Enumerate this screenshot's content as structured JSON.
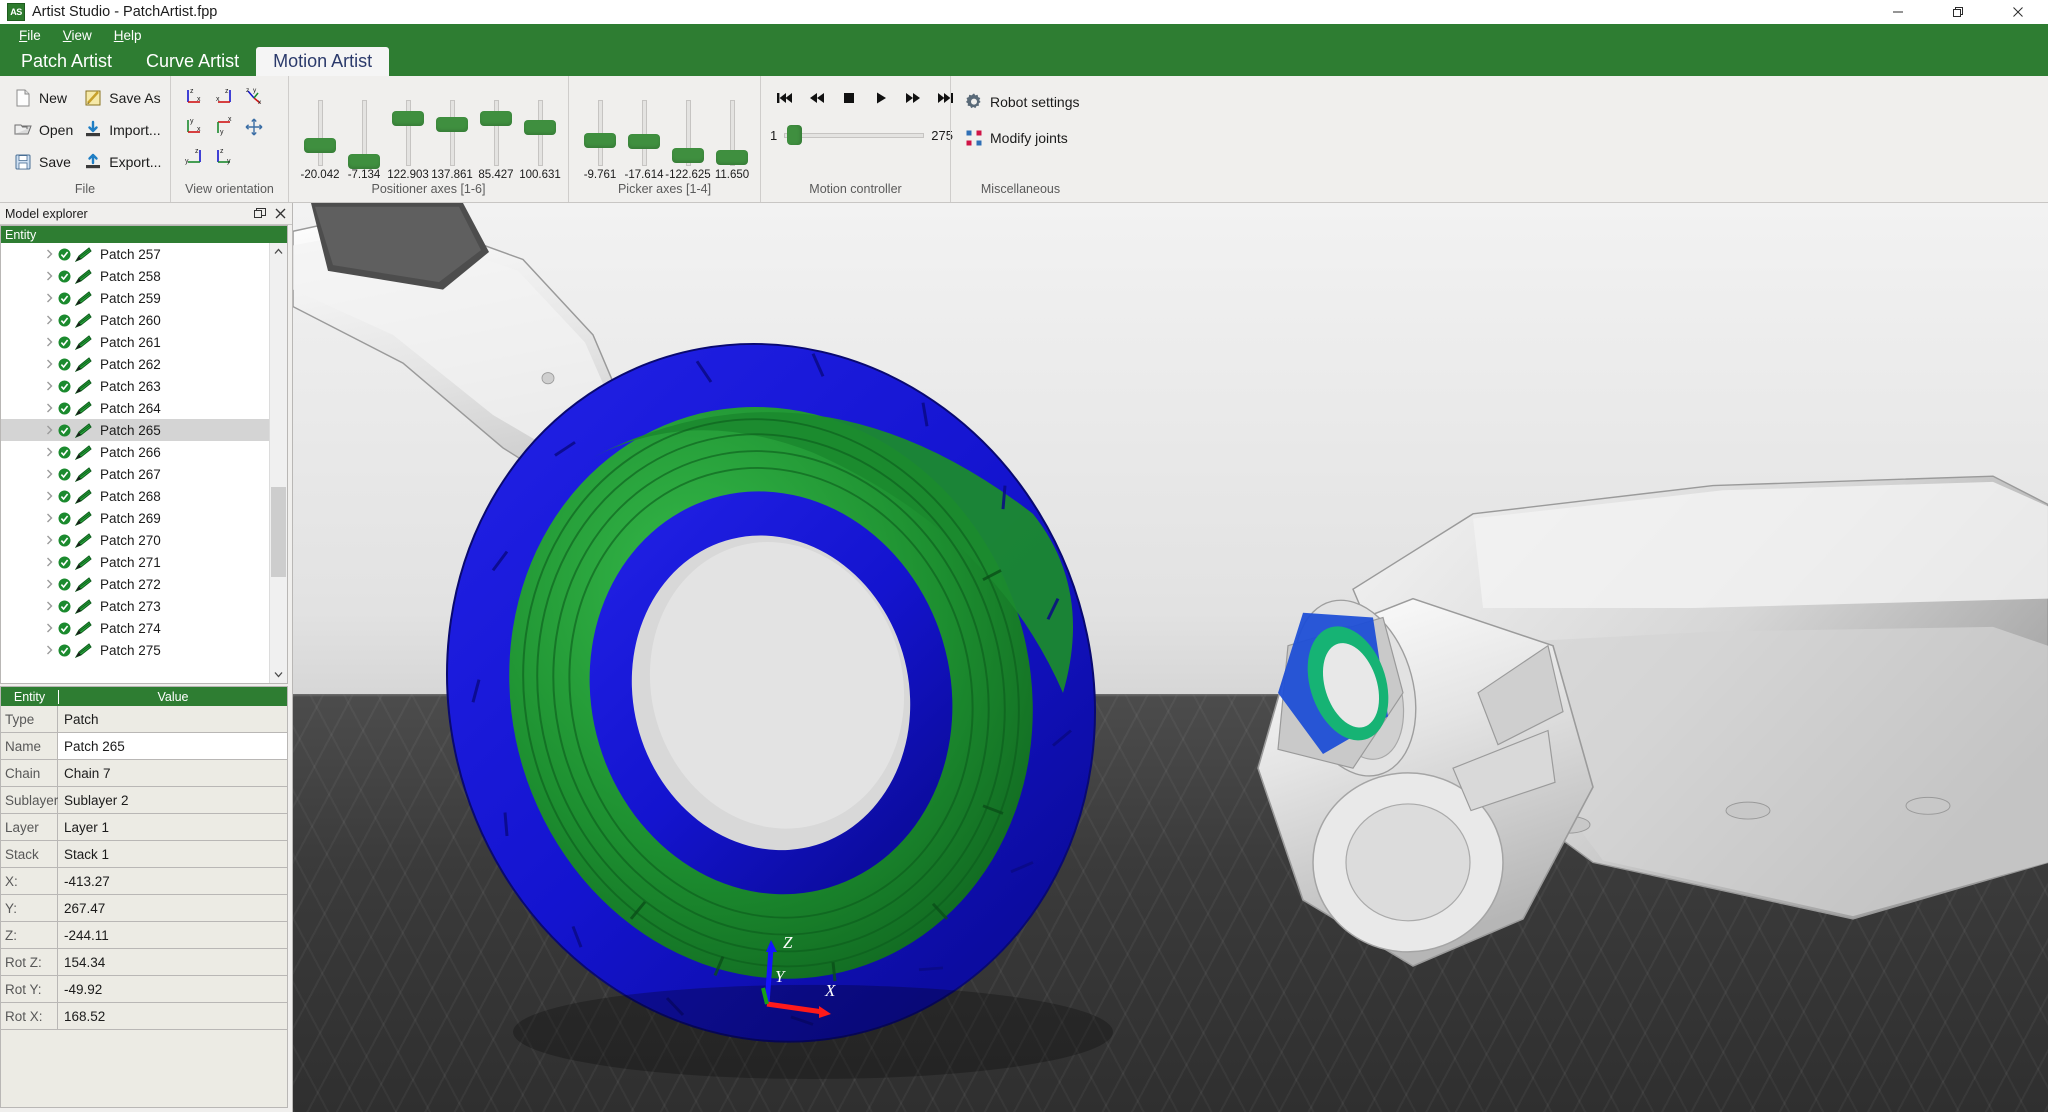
{
  "window": {
    "title": "Artist Studio - PatchArtist.fpp",
    "app_icon": "AS",
    "controls": [
      {
        "name": "minimize",
        "glyph": "minimize-icon"
      },
      {
        "name": "restore",
        "glyph": "restore-icon"
      },
      {
        "name": "close",
        "glyph": "close-icon"
      }
    ]
  },
  "menubar": {
    "items": [
      {
        "label": "File",
        "accel": "F"
      },
      {
        "label": "View",
        "accel": "V"
      },
      {
        "label": "Help",
        "accel": "H"
      }
    ]
  },
  "ribbon_tabs": [
    {
      "label": "Patch Artist",
      "active": false
    },
    {
      "label": "Curve Artist",
      "active": false
    },
    {
      "label": "Motion Artist",
      "active": true
    }
  ],
  "ribbon": {
    "file_group": {
      "label": "File",
      "items": [
        {
          "label": "New",
          "icon": "new-document-icon"
        },
        {
          "label": "Save As",
          "icon": "save-as-icon"
        },
        {
          "label": "Open",
          "icon": "open-folder-icon"
        },
        {
          "label": "Import...",
          "icon": "import-icon"
        },
        {
          "label": "Save",
          "icon": "save-icon"
        },
        {
          "label": "Export...",
          "icon": "export-icon"
        }
      ]
    },
    "view_orientation": {
      "label": "View orientation",
      "buttons": [
        {
          "name": "view-zx-icon"
        },
        {
          "name": "view-xz-icon"
        },
        {
          "name": "view-zyx-isometric-icon"
        },
        {
          "name": "view-yx-icon"
        },
        {
          "name": "view-xy-icon"
        },
        {
          "name": "view-fit-move-icon"
        },
        {
          "name": "view-yz-icon"
        },
        {
          "name": "view-zy-icon"
        }
      ]
    },
    "positioner_axes": {
      "label": "Positioner axes [1-6]",
      "axes": [
        {
          "value": "-20.042",
          "pct": 58
        },
        {
          "value": "-7.134",
          "pct": 82
        },
        {
          "value": "122.903",
          "pct": 16
        },
        {
          "value": "137.861",
          "pct": 26
        },
        {
          "value": "85.427",
          "pct": 17
        },
        {
          "value": "100.631",
          "pct": 31
        }
      ]
    },
    "picker_axes": {
      "label": "Picker axes [1-4]",
      "axes": [
        {
          "value": "-9.761",
          "pct": 50
        },
        {
          "value": "-17.614",
          "pct": 52
        },
        {
          "value": "-122.625",
          "pct": 72
        },
        {
          "value": "11.650",
          "pct": 75
        }
      ]
    },
    "motion_controller": {
      "label": "Motion controller",
      "buttons": [
        {
          "name": "skip-to-start-button",
          "glyph": "skip-back-icon"
        },
        {
          "name": "rewind-button",
          "glyph": "rewind-icon"
        },
        {
          "name": "stop-button",
          "glyph": "stop-icon"
        },
        {
          "name": "play-button",
          "glyph": "play-icon"
        },
        {
          "name": "fast-forward-button",
          "glyph": "fast-forward-icon"
        },
        {
          "name": "skip-to-end-button",
          "glyph": "skip-forward-icon"
        }
      ],
      "frame_min": "1",
      "frame_max": "275",
      "frame_pct": 2
    },
    "miscellaneous": {
      "label": "Miscellaneous",
      "items": [
        {
          "label": "Robot settings",
          "icon": "gear-icon"
        },
        {
          "label": "Modify joints",
          "icon": "joints-icon"
        }
      ]
    }
  },
  "model_explorer": {
    "title": "Model explorer",
    "column_header": "Entity",
    "items": [
      {
        "label": "Patch 257",
        "selected": false
      },
      {
        "label": "Patch 258",
        "selected": false
      },
      {
        "label": "Patch 259",
        "selected": false
      },
      {
        "label": "Patch 260",
        "selected": false
      },
      {
        "label": "Patch 261",
        "selected": false
      },
      {
        "label": "Patch 262",
        "selected": false
      },
      {
        "label": "Patch 263",
        "selected": false
      },
      {
        "label": "Patch 264",
        "selected": false
      },
      {
        "label": "Patch 265",
        "selected": true
      },
      {
        "label": "Patch 266",
        "selected": false
      },
      {
        "label": "Patch 267",
        "selected": false
      },
      {
        "label": "Patch 268",
        "selected": false
      },
      {
        "label": "Patch 269",
        "selected": false
      },
      {
        "label": "Patch 270",
        "selected": false
      },
      {
        "label": "Patch 271",
        "selected": false
      },
      {
        "label": "Patch 272",
        "selected": false
      },
      {
        "label": "Patch 273",
        "selected": false
      },
      {
        "label": "Patch 274",
        "selected": false
      },
      {
        "label": "Patch 275",
        "selected": false
      }
    ]
  },
  "properties": {
    "headers": {
      "key": "Entity",
      "value": "Value"
    },
    "rows": [
      {
        "key": "Type",
        "value": "Patch",
        "editing": false
      },
      {
        "key": "Name",
        "value": "Patch 265",
        "editing": true
      },
      {
        "key": "Chain",
        "value": "Chain 7",
        "editing": false
      },
      {
        "key": "Sublayer",
        "value": "Sublayer 2",
        "editing": false
      },
      {
        "key": "Layer",
        "value": "Layer 1",
        "editing": false
      },
      {
        "key": "Stack",
        "value": "Stack 1",
        "editing": false
      },
      {
        "key": "X:",
        "value": "-413.27",
        "editing": false
      },
      {
        "key": "Y:",
        "value": "267.47",
        "editing": false
      },
      {
        "key": "Z:",
        "value": "-244.11",
        "editing": false
      },
      {
        "key": "Rot Z:",
        "value": "154.34",
        "editing": false
      },
      {
        "key": "Rot Y:",
        "value": "-49.92",
        "editing": false
      },
      {
        "key": "Rot X:",
        "value": "168.52",
        "editing": false
      }
    ]
  },
  "viewport": {
    "axis_gizmo": {
      "x": "X",
      "y": "Y",
      "z": "Z"
    },
    "colors": {
      "patch_blue": "#1414cf",
      "patch_green": "#1b8a2e",
      "accent_green": "#2e7d32",
      "robot_grey": "#e6e6e6",
      "floor_dark": "#3b3b3b"
    }
  }
}
